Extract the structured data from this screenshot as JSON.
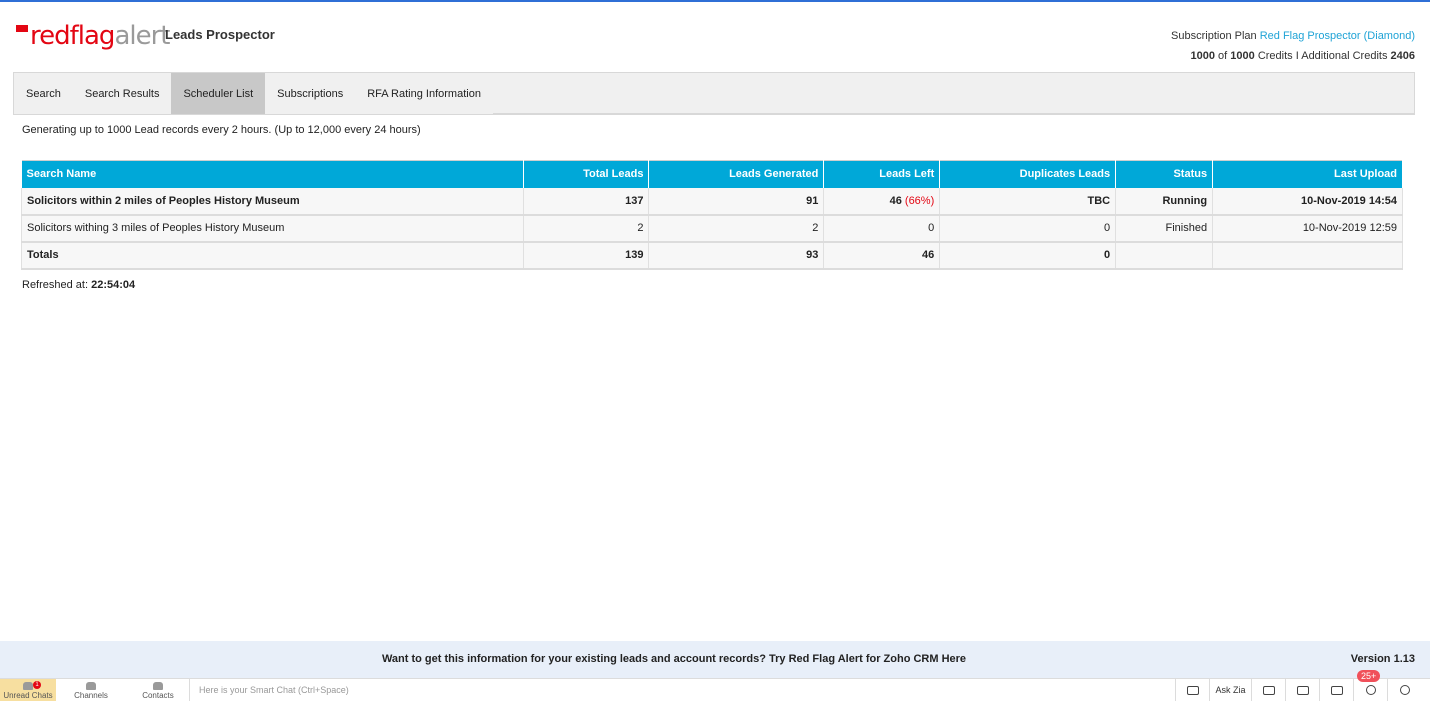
{
  "header": {
    "logo_red": "redflag",
    "logo_grey": "alert",
    "app_name": "Leads Prospector",
    "plan_prefix": "Subscription Plan",
    "plan_name": "Red Flag Prospector (Diamond)",
    "credits_used": "1000",
    "credits_of": "of",
    "credits_total": "1000",
    "credits_label": "Credits I Additional Credits",
    "additional_credits": "2406"
  },
  "tabs": [
    {
      "label": "Search"
    },
    {
      "label": "Search Results"
    },
    {
      "label": "Scheduler List"
    },
    {
      "label": "Subscriptions"
    },
    {
      "label": "RFA Rating Information"
    }
  ],
  "info_text": "Generating up to 1000 Lead records every 2 hours. (Up to 12,000 every 24 hours)",
  "table": {
    "columns": [
      "Search Name",
      "Total Leads",
      "Leads Generated",
      "Leads Left",
      "Duplicates Leads",
      "Status",
      "Last Upload"
    ],
    "rows": [
      {
        "name": "Solicitors within 2 miles of Peoples History Museum",
        "total": "137",
        "generated": "91",
        "left": "46",
        "left_pct": "(66%)",
        "duplicates": "TBC",
        "status": "Running",
        "last_upload": "10-Nov-2019 14:54"
      },
      {
        "name": "Solicitors withing 3 miles of Peoples History Museum",
        "total": "2",
        "generated": "2",
        "left": "0",
        "left_pct": "",
        "duplicates": "0",
        "status": "Finished",
        "last_upload": "10-Nov-2019 12:59"
      }
    ],
    "totals": {
      "name": "Totals",
      "total": "139",
      "generated": "93",
      "left": "46",
      "duplicates": "0",
      "status": "",
      "last_upload": ""
    }
  },
  "refreshed": {
    "label": "Refreshed at:",
    "time": "22:54:04"
  },
  "footer": {
    "message": "Want to get this information for your existing leads and account records? Try Red Flag Alert for Zoho CRM Here",
    "version": "Version 1.13"
  },
  "taskbar": {
    "unread": "Unread Chats",
    "unread_count": "1",
    "channels": "Channels",
    "contacts": "Contacts",
    "smart_chat_placeholder": "Here is your Smart Chat (Ctrl+Space)",
    "ask_zia": "Ask Zia",
    "notif_badge": "25+"
  },
  "colors": {
    "brand_red": "#e30613",
    "header_blue": "#00a8d8",
    "link_blue": "#1fa3d6"
  }
}
